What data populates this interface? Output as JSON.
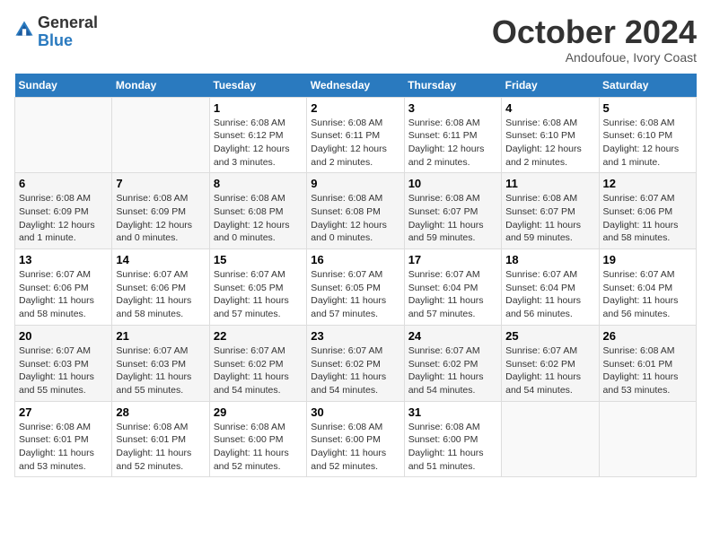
{
  "logo": {
    "general": "General",
    "blue": "Blue"
  },
  "header": {
    "month": "October 2024",
    "location": "Andoufoue, Ivory Coast"
  },
  "weekdays": [
    "Sunday",
    "Monday",
    "Tuesday",
    "Wednesday",
    "Thursday",
    "Friday",
    "Saturday"
  ],
  "weeks": [
    [
      {
        "day": "",
        "info": ""
      },
      {
        "day": "",
        "info": ""
      },
      {
        "day": "1",
        "info": "Sunrise: 6:08 AM\nSunset: 6:12 PM\nDaylight: 12 hours\nand 3 minutes."
      },
      {
        "day": "2",
        "info": "Sunrise: 6:08 AM\nSunset: 6:11 PM\nDaylight: 12 hours\nand 2 minutes."
      },
      {
        "day": "3",
        "info": "Sunrise: 6:08 AM\nSunset: 6:11 PM\nDaylight: 12 hours\nand 2 minutes."
      },
      {
        "day": "4",
        "info": "Sunrise: 6:08 AM\nSunset: 6:10 PM\nDaylight: 12 hours\nand 2 minutes."
      },
      {
        "day": "5",
        "info": "Sunrise: 6:08 AM\nSunset: 6:10 PM\nDaylight: 12 hours\nand 1 minute."
      }
    ],
    [
      {
        "day": "6",
        "info": "Sunrise: 6:08 AM\nSunset: 6:09 PM\nDaylight: 12 hours\nand 1 minute."
      },
      {
        "day": "7",
        "info": "Sunrise: 6:08 AM\nSunset: 6:09 PM\nDaylight: 12 hours\nand 0 minutes."
      },
      {
        "day": "8",
        "info": "Sunrise: 6:08 AM\nSunset: 6:08 PM\nDaylight: 12 hours\nand 0 minutes."
      },
      {
        "day": "9",
        "info": "Sunrise: 6:08 AM\nSunset: 6:08 PM\nDaylight: 12 hours\nand 0 minutes."
      },
      {
        "day": "10",
        "info": "Sunrise: 6:08 AM\nSunset: 6:07 PM\nDaylight: 11 hours\nand 59 minutes."
      },
      {
        "day": "11",
        "info": "Sunrise: 6:08 AM\nSunset: 6:07 PM\nDaylight: 11 hours\nand 59 minutes."
      },
      {
        "day": "12",
        "info": "Sunrise: 6:07 AM\nSunset: 6:06 PM\nDaylight: 11 hours\nand 58 minutes."
      }
    ],
    [
      {
        "day": "13",
        "info": "Sunrise: 6:07 AM\nSunset: 6:06 PM\nDaylight: 11 hours\nand 58 minutes."
      },
      {
        "day": "14",
        "info": "Sunrise: 6:07 AM\nSunset: 6:06 PM\nDaylight: 11 hours\nand 58 minutes."
      },
      {
        "day": "15",
        "info": "Sunrise: 6:07 AM\nSunset: 6:05 PM\nDaylight: 11 hours\nand 57 minutes."
      },
      {
        "day": "16",
        "info": "Sunrise: 6:07 AM\nSunset: 6:05 PM\nDaylight: 11 hours\nand 57 minutes."
      },
      {
        "day": "17",
        "info": "Sunrise: 6:07 AM\nSunset: 6:04 PM\nDaylight: 11 hours\nand 57 minutes."
      },
      {
        "day": "18",
        "info": "Sunrise: 6:07 AM\nSunset: 6:04 PM\nDaylight: 11 hours\nand 56 minutes."
      },
      {
        "day": "19",
        "info": "Sunrise: 6:07 AM\nSunset: 6:04 PM\nDaylight: 11 hours\nand 56 minutes."
      }
    ],
    [
      {
        "day": "20",
        "info": "Sunrise: 6:07 AM\nSunset: 6:03 PM\nDaylight: 11 hours\nand 55 minutes."
      },
      {
        "day": "21",
        "info": "Sunrise: 6:07 AM\nSunset: 6:03 PM\nDaylight: 11 hours\nand 55 minutes."
      },
      {
        "day": "22",
        "info": "Sunrise: 6:07 AM\nSunset: 6:02 PM\nDaylight: 11 hours\nand 54 minutes."
      },
      {
        "day": "23",
        "info": "Sunrise: 6:07 AM\nSunset: 6:02 PM\nDaylight: 11 hours\nand 54 minutes."
      },
      {
        "day": "24",
        "info": "Sunrise: 6:07 AM\nSunset: 6:02 PM\nDaylight: 11 hours\nand 54 minutes."
      },
      {
        "day": "25",
        "info": "Sunrise: 6:07 AM\nSunset: 6:02 PM\nDaylight: 11 hours\nand 54 minutes."
      },
      {
        "day": "26",
        "info": "Sunrise: 6:08 AM\nSunset: 6:01 PM\nDaylight: 11 hours\nand 53 minutes."
      }
    ],
    [
      {
        "day": "27",
        "info": "Sunrise: 6:08 AM\nSunset: 6:01 PM\nDaylight: 11 hours\nand 53 minutes."
      },
      {
        "day": "28",
        "info": "Sunrise: 6:08 AM\nSunset: 6:01 PM\nDaylight: 11 hours\nand 52 minutes."
      },
      {
        "day": "29",
        "info": "Sunrise: 6:08 AM\nSunset: 6:00 PM\nDaylight: 11 hours\nand 52 minutes."
      },
      {
        "day": "30",
        "info": "Sunrise: 6:08 AM\nSunset: 6:00 PM\nDaylight: 11 hours\nand 52 minutes."
      },
      {
        "day": "31",
        "info": "Sunrise: 6:08 AM\nSunset: 6:00 PM\nDaylight: 11 hours\nand 51 minutes."
      },
      {
        "day": "",
        "info": ""
      },
      {
        "day": "",
        "info": ""
      }
    ]
  ]
}
